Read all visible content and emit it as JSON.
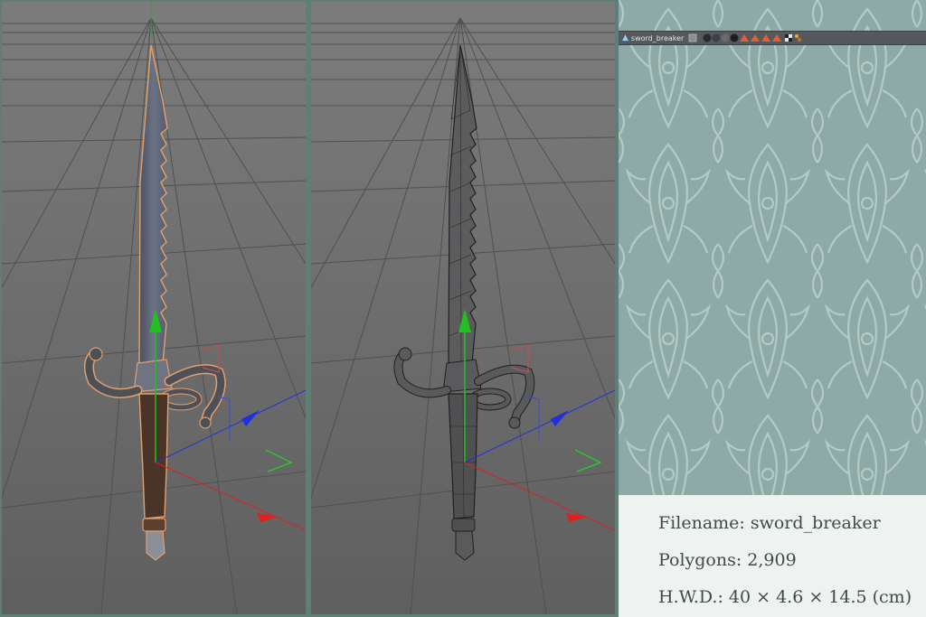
{
  "object_bar": {
    "object_name": "sword_breaker",
    "icons": [
      "null-object-icon",
      "tag-icon",
      "material-ball-icon",
      "material-ball-icon",
      "material-ball-icon",
      "material-ball-icon",
      "cone-icon",
      "cone-icon",
      "cone-icon",
      "cone-icon",
      "checker-material-icon",
      "texture-tag-icon"
    ]
  },
  "viewports": [
    {
      "name": "shaded",
      "display_mode": "shaded"
    },
    {
      "name": "wireframe",
      "display_mode": "shaded-with-lines"
    }
  ],
  "info": {
    "filename": "Filename: sword_breaker",
    "polygons": "Polygons: 2,909",
    "hwd": "H.W.D.: 40 × 4.6 × 14.5 (cm)"
  },
  "colors": {
    "frame": "#5e7f76",
    "viewport_bg": "#6e6e6e",
    "wallpaper": "#8eaaa6",
    "info_bg": "#eef2f0",
    "selection_outline": "#e0a070",
    "axis_x": "#e02020",
    "axis_y": "#20c020",
    "axis_z": "#2030e0"
  }
}
